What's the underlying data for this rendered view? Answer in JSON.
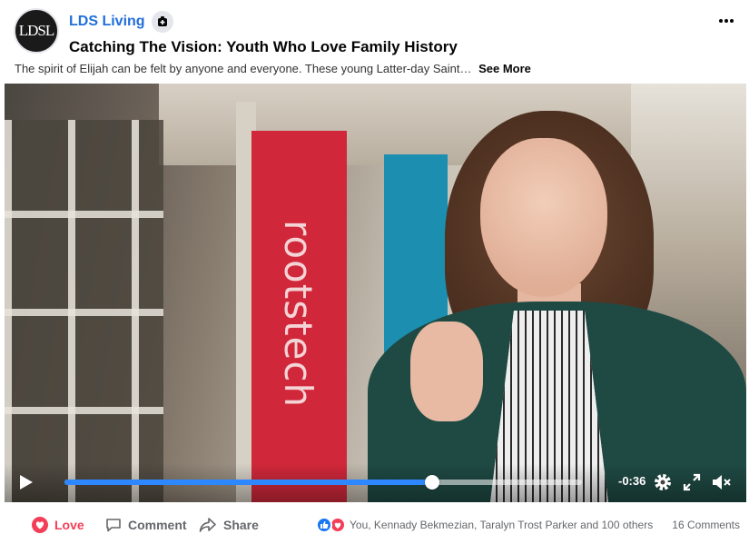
{
  "post": {
    "avatar_text": "LDSL",
    "page_name": "LDS Living",
    "title": "Catching The Vision: Youth Who Love Family History",
    "description": "The spirit of Elijah can be felt by anyone and everyone. These young Latter-day Saint…",
    "see_more": "See More"
  },
  "video": {
    "banner_text": "rootstech",
    "time_remaining": "-0:36",
    "progress": 0.71,
    "icons": [
      "play-icon",
      "settings-icon",
      "fullscreen-icon",
      "volume-muted-icon"
    ]
  },
  "actions": {
    "love_label": "Love",
    "comment_label": "Comment",
    "share_label": "Share",
    "reactions_text": "You, Kennady Bekmezian, Taralyn Trost Parker and 100 others",
    "comments_count": "16 Comments"
  },
  "colors": {
    "link_blue": "#216fdb",
    "love_red": "#f33e58",
    "progress_blue": "#2d88ff"
  }
}
